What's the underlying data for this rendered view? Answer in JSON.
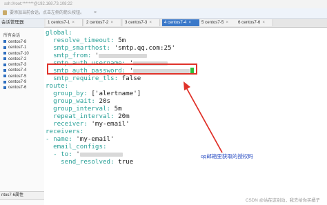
{
  "window": {
    "title": "ssh://root:*******@192.168.73.108:22"
  },
  "hint": {
    "text": "要添加当前会话，点击左侧的箭头按钮。",
    "close_glyph": "×"
  },
  "sidebar": {
    "header": "会话管理器",
    "group": "所有会话",
    "items": [
      "centos7-8",
      "centos7-1",
      "centos7-10",
      "centos7-2",
      "centos7-3",
      "centos7-4",
      "centos7-5",
      "centos7-9",
      "centos7-6"
    ],
    "bottom_label": "ntos7-6属性"
  },
  "tabs": [
    {
      "label": "1 centos7-1",
      "active": false
    },
    {
      "label": "2 centos7-2",
      "active": false
    },
    {
      "label": "3 centos7-3",
      "active": false
    },
    {
      "label": "4 centos7-4",
      "active": true
    },
    {
      "label": "5 centos7-5",
      "active": false
    },
    {
      "label": "6 centos7-6",
      "active": false
    }
  ],
  "tab_close_glyph": "×",
  "terminal": {
    "lines": [
      {
        "key": "global:",
        "value": ""
      },
      {
        "key": "  resolve_timeout:",
        "value": " 5m"
      },
      {
        "key": "  smtp_smarthost:",
        "value": " 'smtp.qq.com:25'"
      },
      {
        "key": "  smtp_from:",
        "value": " '"
      },
      {
        "key": "  smtp_auth_username:",
        "value": " '"
      },
      {
        "key": "  smtp_auth_password:",
        "value": " '"
      },
      {
        "key": "  smtp_require_tls:",
        "value": " false"
      },
      {
        "key": "route:",
        "value": ""
      },
      {
        "key": "  group_by:",
        "value": " ['alertname']"
      },
      {
        "key": "  group_wait:",
        "value": " 20s"
      },
      {
        "key": "  group_interval:",
        "value": " 5m"
      },
      {
        "key": "  repeat_interval:",
        "value": " 20m"
      },
      {
        "key": "  receiver:",
        "value": " 'my-email'"
      },
      {
        "key": "receivers:",
        "value": ""
      },
      {
        "key": "- name:",
        "value": " 'my-email'"
      },
      {
        "key": "  email_configs:",
        "value": ""
      },
      {
        "key": "  - to:",
        "value": " '"
      },
      {
        "key": "    send_resolved:",
        "value": " true"
      }
    ]
  },
  "annotation": {
    "text": "qq邮箱里获取的授权码",
    "highlight_color": "#e0322a",
    "text_color": "#2b4fc4"
  },
  "watermark": "CSDN @站在这别动，我去给你买橘子"
}
